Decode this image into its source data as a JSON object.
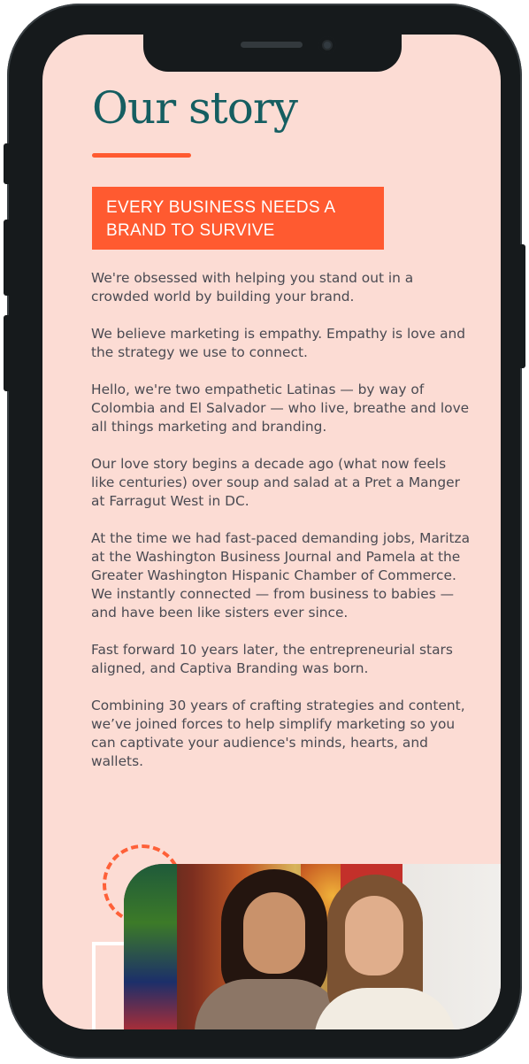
{
  "page": {
    "title": "Our story",
    "banner": "EVERY BUSINESS NEEDS A BRAND TO SURVIVE",
    "paragraphs": [
      "We're obsessed with helping you stand out in a crowded world by building your brand.",
      "We believe marketing is empathy. Empathy is love and the strategy we use to connect.",
      "Hello, we're two empathetic Latinas — by way of Colombia and El Salvador — who live, breathe and love all things marketing and branding.",
      "Our love story begins a decade ago (what now feels like centuries) over soup and salad at a Pret a Manger at Farragut West in DC.",
      "At the time we had fast-paced demanding jobs, Maritza at the Washington Business Journal and Pamela at the Greater Washington Hispanic Chamber of Commerce. We instantly connected — from business to babies — and have been like sisters ever since.",
      "Fast forward 10 years later, the entrepreneurial stars aligned, and Captiva Branding was born.",
      "Combining 30 years of crafting strategies and content, we’ve joined forces to help simplify marketing so you can captivate your audience's minds, hearts, and wallets."
    ]
  },
  "colors": {
    "background": "#fcdcd4",
    "title": "#155e61",
    "accent": "#ff5a30",
    "body_text": "#4a4a52",
    "phone_frame": "#161a1c"
  }
}
